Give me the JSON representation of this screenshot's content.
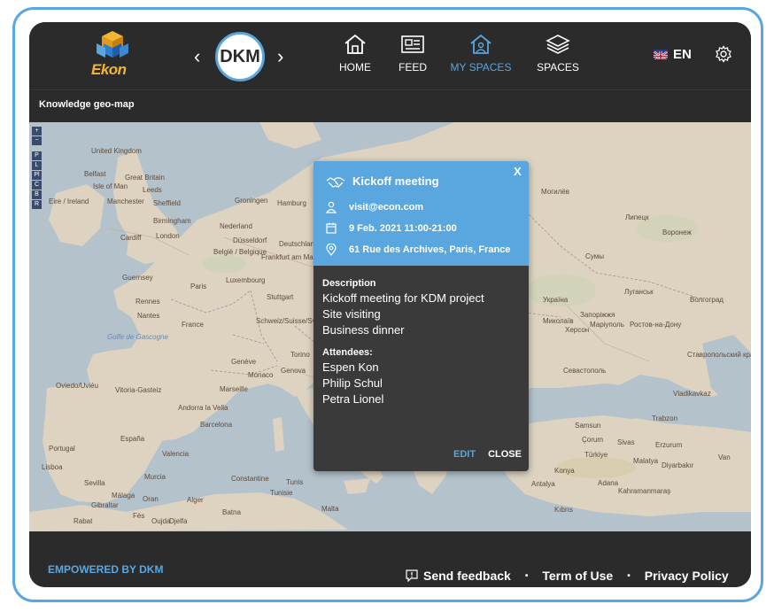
{
  "brand": {
    "logo_text": "Ekon",
    "space_badge": "DKM"
  },
  "nav": {
    "prev_arrow": "‹",
    "next_arrow": "›",
    "items": [
      {
        "label": "HOME",
        "icon": "home-icon"
      },
      {
        "label": "FEED",
        "icon": "newspaper-icon"
      },
      {
        "label": "MY SPACES",
        "icon": "my-spaces-icon",
        "active": true
      },
      {
        "label": "SPACES",
        "icon": "layers-icon"
      }
    ],
    "language": "EN"
  },
  "subbar": {
    "title": "Knowledge geo-map"
  },
  "map": {
    "controls": [
      "+",
      "−",
      "P",
      "L",
      "Pl",
      "C",
      "B",
      "R"
    ],
    "labels": [
      "United Kingdom",
      "Belfast",
      "Great Britain",
      "Isle of Man",
      "Leeds",
      "Eire / Ireland",
      "Manchester",
      "Sheffield",
      "Birmingham",
      "Cardiff",
      "London",
      "Guernsey",
      "Groningen",
      "Hamburg",
      "Nederland",
      "Düsseldorf",
      "Deutschland",
      "België / Belgique",
      "Frankfurt am Main",
      "Luxembourg",
      "Stuttgart",
      "Paris",
      "Rennes",
      "Nantes",
      "France",
      "Schweiz/Suisse/Svizzera",
      "Genève",
      "Torino",
      "Monaco",
      "Genova",
      "Marseille",
      "Golfe de Gascogne",
      "Oviedo/Uviéu",
      "Vitoria-Gasteiz",
      "Andorra la Vella",
      "Barcelona",
      "España",
      "Portugal",
      "Lisboa",
      "Valencia",
      "Murcia",
      "Sevilla",
      "Málaga",
      "Gibraltar",
      "Oran",
      "Alger",
      "Constantine",
      "Batna",
      "Rabat",
      "Fès",
      "Oujda",
      "Djelfa",
      "Tunisie",
      "Tunis",
      "Malta",
      "Могилёв",
      "Липецк",
      "Воронеж",
      "Сумы",
      "Україна",
      "Луганськ",
      "Волгоград",
      "Запоріжжя",
      "Миколаїв",
      "Херсон",
      "Маріуполь",
      "Ростов-на-Дону",
      "Севастополь",
      "Ставропольский край",
      "Vladikavkaz",
      "Samsun",
      "Trabzon",
      "Sivas",
      "Erzurum",
      "Türkiye",
      "Malatya",
      "Diyarbakır",
      "Konya",
      "Adana",
      "Antalya",
      "Kahramanmaraş",
      "Kıbrıs",
      "Çorum",
      "Van"
    ]
  },
  "event": {
    "title": "Kickoff meeting",
    "close_x": "X",
    "email": "visit@econ.com",
    "datetime": "9 Feb. 2021 11:00-21:00",
    "address": "61 Rue des Archives, Paris, France",
    "description_label": "Description",
    "description_lines": [
      "Kickoff meeting for KDM project",
      "Site visiting",
      "Business dinner"
    ],
    "attendees_label": "Attendees:",
    "attendees": [
      "Espen Kon",
      "Philip Schul",
      "Petra Lionel"
    ],
    "edit_label": "EDIT",
    "close_label": "CLOSE"
  },
  "footer": {
    "empowered": "EMPOWERED BY DKM",
    "send_feedback": "Send feedback",
    "separator": "•",
    "terms": "Term of Use",
    "privacy": "Privacy Policy"
  },
  "colors": {
    "accent": "#5aa6df",
    "background": "#2b2b2b",
    "popup_body": "#3a3a3a",
    "logo_gold": "#f2b632"
  }
}
